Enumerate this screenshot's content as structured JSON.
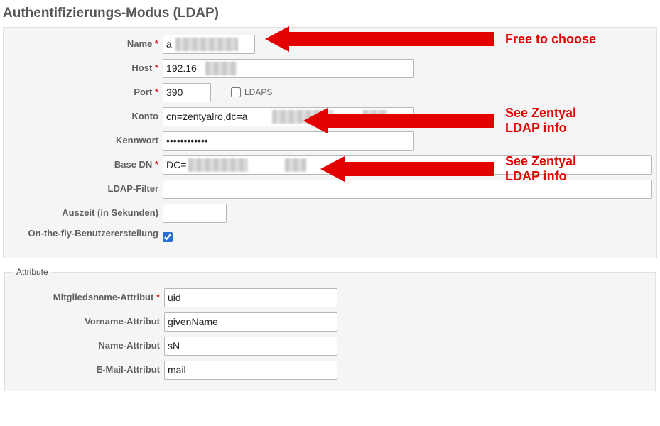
{
  "page_title": "Authentifizierungs-Modus (LDAP)",
  "required_marker": "*",
  "main": {
    "name": {
      "label": "Name",
      "value": "a",
      "required": true
    },
    "host": {
      "label": "Host",
      "value": "192.16",
      "required": true
    },
    "port": {
      "label": "Port",
      "value": "390",
      "required": true
    },
    "ldaps": {
      "label": "LDAPS",
      "checked": false
    },
    "konto": {
      "label": "Konto",
      "value": "cn=zentyalro,dc=a            ,dc=",
      "required": false
    },
    "kennwort": {
      "label": "Kennwort",
      "value": "••••••••••••",
      "required": false
    },
    "base_dn": {
      "label": "Base DN",
      "value": "DC=            ,DC=i",
      "required": true
    },
    "filter": {
      "label": "LDAP-Filter",
      "value": "",
      "required": false
    },
    "timeout": {
      "label": "Auszeit (in Sekunden)",
      "value": "",
      "required": false
    },
    "onthefly": {
      "label": "On-the-fly-Benutzererstellung",
      "checked": true
    }
  },
  "attributes_legend": "Attribute",
  "attrs": {
    "uid": {
      "label": "Mitgliedsname-Attribut",
      "value": "uid",
      "required": true
    },
    "first": {
      "label": "Vorname-Attribut",
      "value": "givenName",
      "required": false
    },
    "last": {
      "label": "Name-Attribut",
      "value": "sN",
      "required": false
    },
    "mail": {
      "label": "E-Mail-Attribut",
      "value": "mail",
      "required": false
    }
  },
  "annotations": {
    "a1": "Free to choose",
    "a2": "See Zentyal\nLDAP info",
    "a3": "See Zentyal\nLDAP info"
  }
}
